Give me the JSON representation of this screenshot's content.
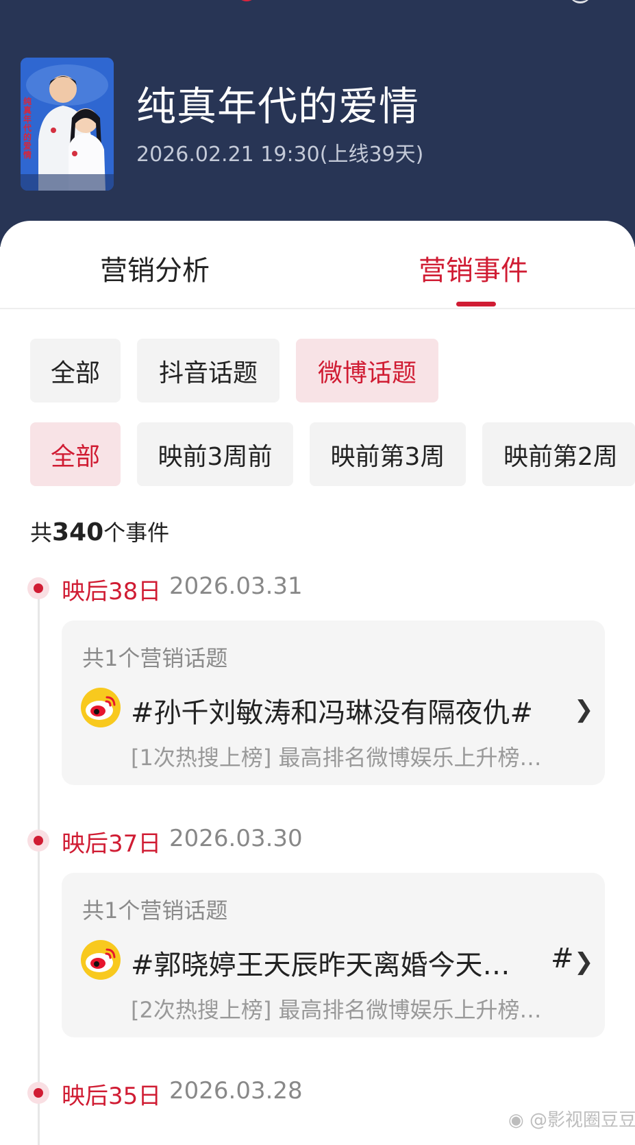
{
  "header": {
    "title": "纯真年代的爱情",
    "release": "2026.02.21 19:30(上线39天)",
    "poster_text": "纯真年代的爱情"
  },
  "tabs": [
    {
      "label": "营销分析",
      "active": false
    },
    {
      "label": "营销事件",
      "active": true
    }
  ],
  "platform_filters": [
    {
      "label": "全部",
      "active": false
    },
    {
      "label": "抖音话题",
      "active": false
    },
    {
      "label": "微博话题",
      "active": true
    }
  ],
  "period_filters": [
    {
      "label": "全部",
      "active": true
    },
    {
      "label": "映前3周前",
      "active": false
    },
    {
      "label": "映前第3周",
      "active": false
    },
    {
      "label": "映前第2周",
      "active": false
    }
  ],
  "summary": {
    "prefix": "共",
    "count": "340",
    "suffix": "个事件"
  },
  "events": [
    {
      "day": "映后38日",
      "date": "2026.03.31",
      "topic_count": "共1个营销话题",
      "topic": "#孙千刘敏涛和冯琳没有隔夜仇#",
      "topic_tail": "",
      "detail": "[1次热搜上榜] 最高排名微博娱乐上升榜…"
    },
    {
      "day": "映后37日",
      "date": "2026.03.30",
      "topic_count": "共1个营销话题",
      "topic": "#郭晓婷王天辰昨天离婚今天…",
      "topic_tail": "#",
      "detail": "[2次热搜上榜] 最高排名微博娱乐上升榜…"
    },
    {
      "day": "映后35日",
      "date": "2026.03.28"
    }
  ],
  "watermark": "@影视圈豆豆",
  "colors": {
    "header_bg": "#283555",
    "accent": "#d01c33",
    "chip_bg": "#f3f3f3",
    "chip_active_bg": "#f8e3e6",
    "weibo_yellow": "#f8c91e"
  },
  "icons": {
    "platform": "weibo-icon",
    "more": "chevron-right-icon"
  }
}
